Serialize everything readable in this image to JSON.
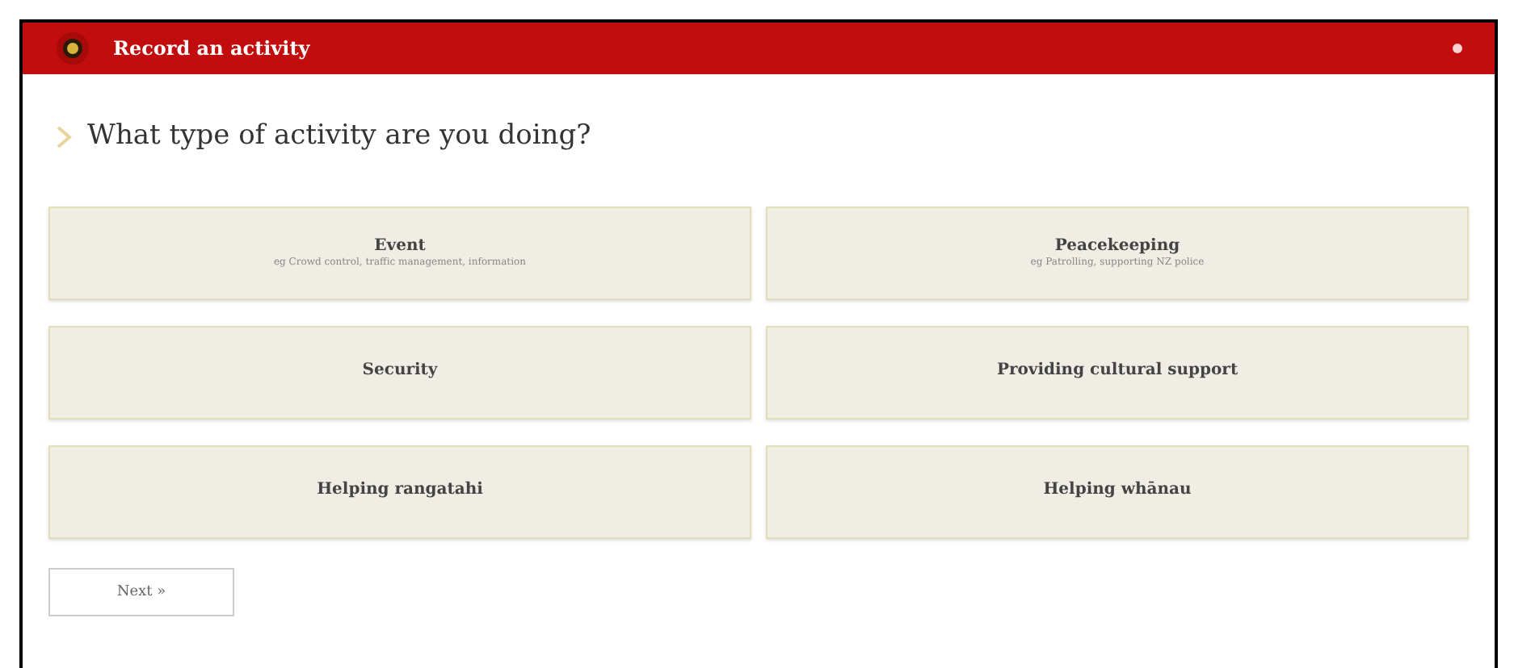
{
  "header": {
    "title": "Record an activity"
  },
  "question": "What type of activity are you doing?",
  "options": [
    {
      "label": "Event",
      "hint": "eg Crowd control, traffic management, information"
    },
    {
      "label": "Peacekeeping",
      "hint": "eg Patrolling, supporting NZ police"
    },
    {
      "label": "Security"
    },
    {
      "label": "Providing cultural support"
    },
    {
      "label": "Helping rangatahi"
    },
    {
      "label": "Helping whānau"
    }
  ],
  "next_button": "Next »"
}
